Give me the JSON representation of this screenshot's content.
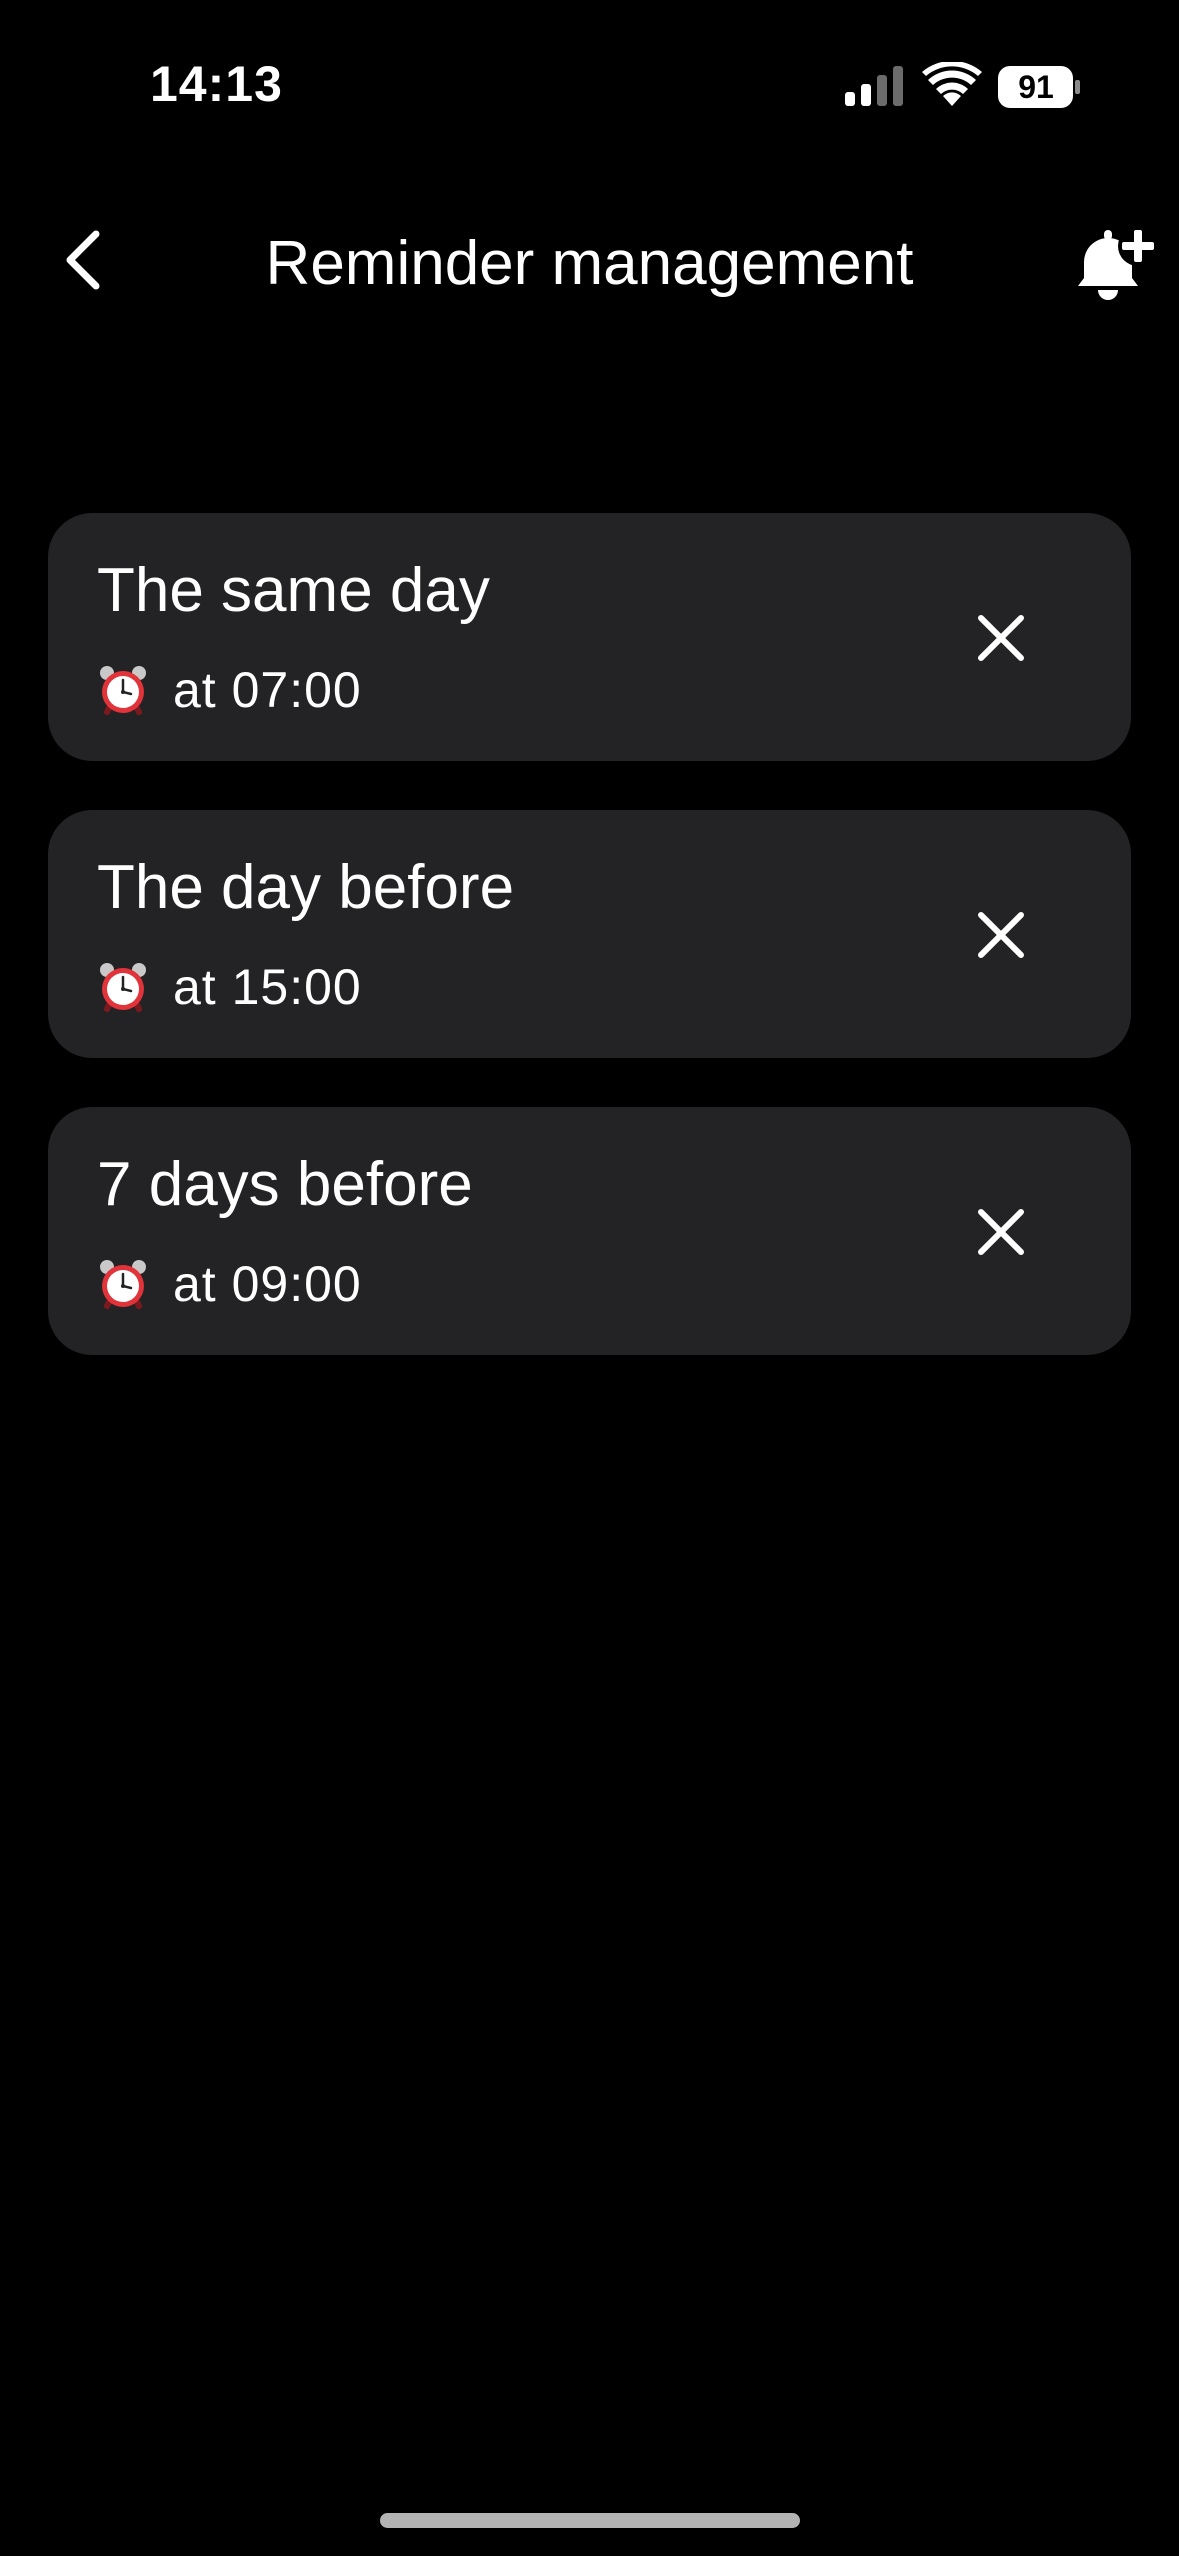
{
  "status_bar": {
    "time": "14:13",
    "battery": "91",
    "icons": [
      "signal-icon",
      "wifi-icon",
      "battery-icon"
    ]
  },
  "header": {
    "title": "Reminder management",
    "back_icon": "chevron-left-icon",
    "add_icon": "bell-plus-icon"
  },
  "reminders": [
    {
      "title": "The same day",
      "time": "at 07:00",
      "icon": "alarm-clock-icon",
      "action_icon": "close-icon"
    },
    {
      "title": "The day before",
      "time": "at 15:00",
      "icon": "alarm-clock-icon",
      "action_icon": "close-icon"
    },
    {
      "title": "7 days before",
      "time": "at 09:00",
      "icon": "alarm-clock-icon",
      "action_icon": "close-icon"
    }
  ],
  "colors": {
    "background": "#000000",
    "card": "#232325",
    "text": "#ffffff",
    "alarm_red": "#e0333a"
  }
}
